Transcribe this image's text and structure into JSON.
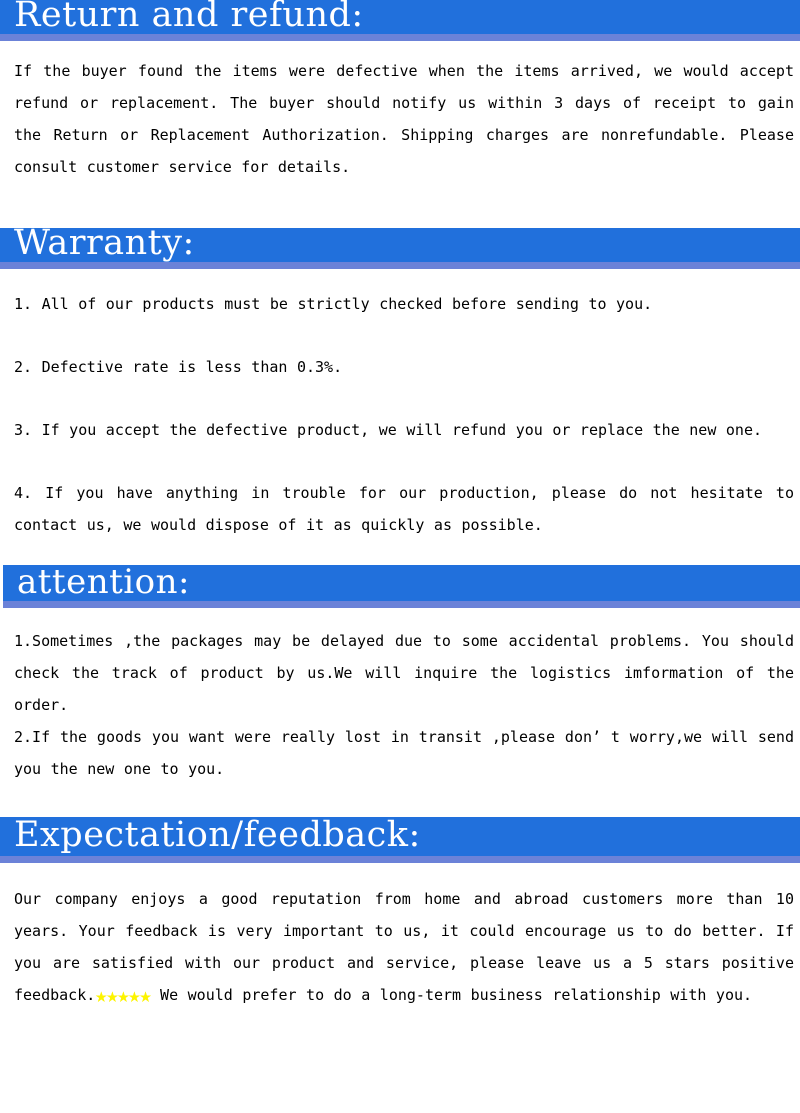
{
  "colors": {
    "banner_blue": "#2170dc",
    "banner_underline": "#6b82d8",
    "banner_text": "#ffffff",
    "body_text": "#000000",
    "star_yellow": "#fdf400",
    "page_background": "#ffffff"
  },
  "sections": {
    "return": {
      "heading": "Return and refund:",
      "paragraphs": [
        "If the buyer found the items were defective when the items arrived, we would accept refund or replacement. The buyer should notify us within 3 days of receipt to gain the Return or Replacement Authorization. Shipping charges are nonrefundable. Please consult customer service for details."
      ]
    },
    "warranty": {
      "heading": "Warranty:",
      "items": [
        "1. All of our products must be strictly checked before sending to you.",
        "2. Defective rate is less than 0.3%.",
        "3. If you accept the defective product, we will refund you or replace the new one.",
        "4. If you have anything in trouble for our production, please do not hesitate to contact us, we would dispose of it as quickly as possible."
      ]
    },
    "attention": {
      "heading": "attention:",
      "items": [
        "1.Sometimes ,the packages may be delayed due to some accidental problems. You should check the track of product by us.We will inquire the logistics imformation of the order.",
        "2.If the goods you want were really lost in transit ,please don’ t worry,we will send you the new one to you."
      ]
    },
    "expectation": {
      "heading": "Expectation/feedback:",
      "paragraph_before_stars": "Our company enjoys a good reputation from home and abroad customers more than 10 years. Your feedback is very important to us, it could encourage us to do better. If you are satisfied with our product and service, please leave us a 5 stars positive feedback.",
      "star_glyph": "★",
      "star_count": 5,
      "paragraph_after_stars": " We would prefer to do a long-term business relationship with you."
    }
  }
}
